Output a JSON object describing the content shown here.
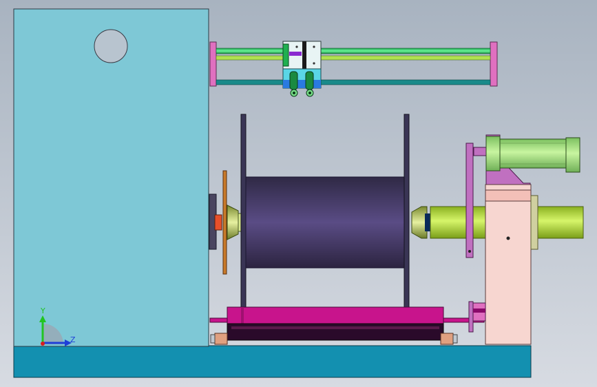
{
  "viewport": {
    "background_top": "#a8b3c0",
    "background_bottom": "#d7dbe2"
  },
  "triad": {
    "y_label": "Y",
    "z_label": "Z",
    "y_color": "#22c422",
    "z_color": "#1e3fd8",
    "x_color": "#d81e1e"
  },
  "colors": {
    "housing": "#7ec8d6",
    "base": "#1390b0",
    "drum": "#4f4275",
    "flange": "#3a3555",
    "rail_green": "#3de07a",
    "rail_teal": "#1a8a8a",
    "rail_end": "#e070c0",
    "carriage_magenta": "#c8148c",
    "carriage_dark": "#2a0a2a",
    "cylinder_green": "#b4e640",
    "cylinder_light": "#9fe879",
    "bracket_pink": "#f7d6d0",
    "bracket_violet": "#c070c0",
    "pad_tan": "#e0a080",
    "brake_orange": "#c87a2a"
  }
}
